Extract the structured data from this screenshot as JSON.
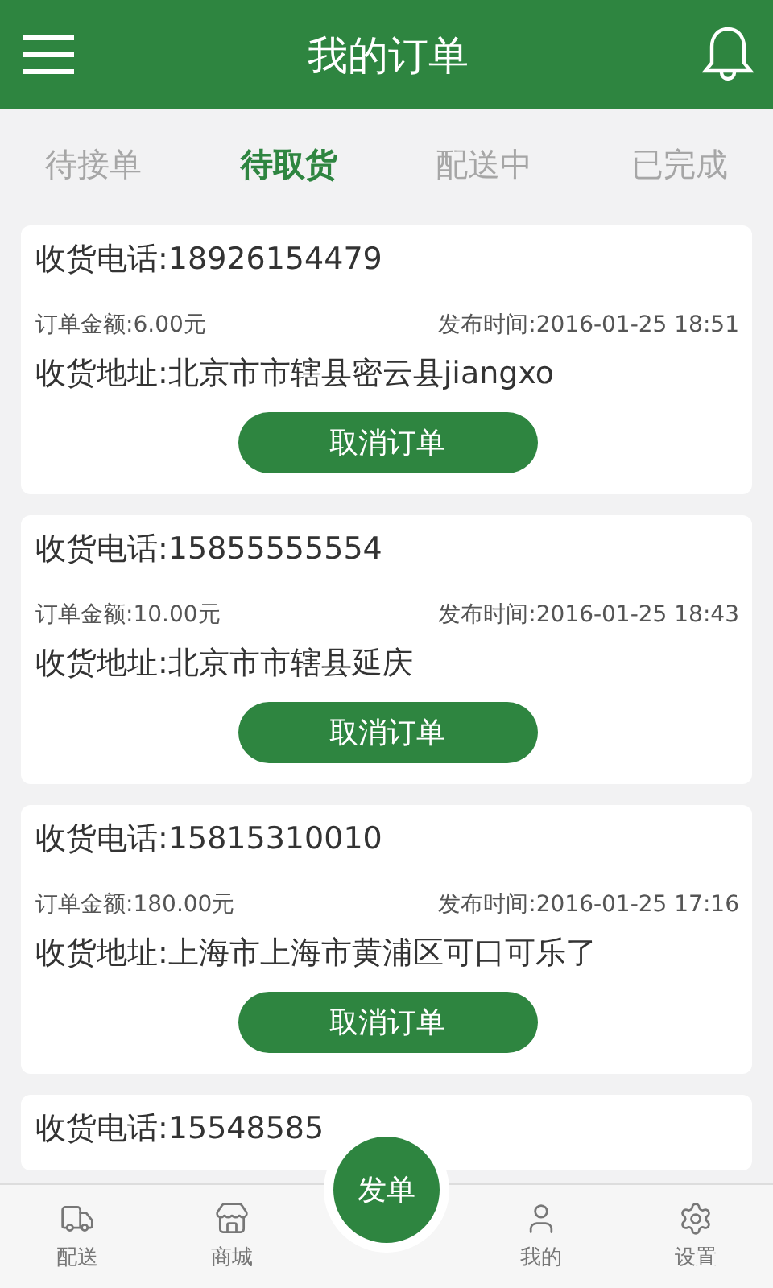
{
  "header": {
    "title": "我的订单"
  },
  "tabs": [
    {
      "label": "待接单",
      "selected": false
    },
    {
      "label": "待取货",
      "selected": true
    },
    {
      "label": "配送中",
      "selected": false
    },
    {
      "label": "已完成",
      "selected": false
    }
  ],
  "orders": [
    {
      "phone": "收货电话:18926154479",
      "amount": "订单金额:6.00元",
      "time": "发布时间:2016-01-25 18:51",
      "address": "收货地址:北京市市辖县密云县jiangxo",
      "action": "取消订单"
    },
    {
      "phone": "收货电话:15855555554",
      "amount": "订单金额:10.00元",
      "time": "发布时间:2016-01-25 18:43",
      "address": "收货地址:北京市市辖县延庆",
      "action": "取消订单"
    },
    {
      "phone": "收货电话:15815310010",
      "amount": "订单金额:180.00元",
      "time": "发布时间:2016-01-25 17:16",
      "address": "收货地址:上海市上海市黄浦区可口可乐了",
      "action": "取消订单"
    },
    {
      "phone": "收货电话:15548585"
    }
  ],
  "bottom_nav": [
    {
      "kind": "tab",
      "label": "配送"
    },
    {
      "kind": "tab",
      "label": "商城"
    },
    {
      "kind": "fab",
      "label": "发单"
    },
    {
      "kind": "tab",
      "label": "我的"
    },
    {
      "kind": "tab",
      "label": "设置"
    }
  ]
}
